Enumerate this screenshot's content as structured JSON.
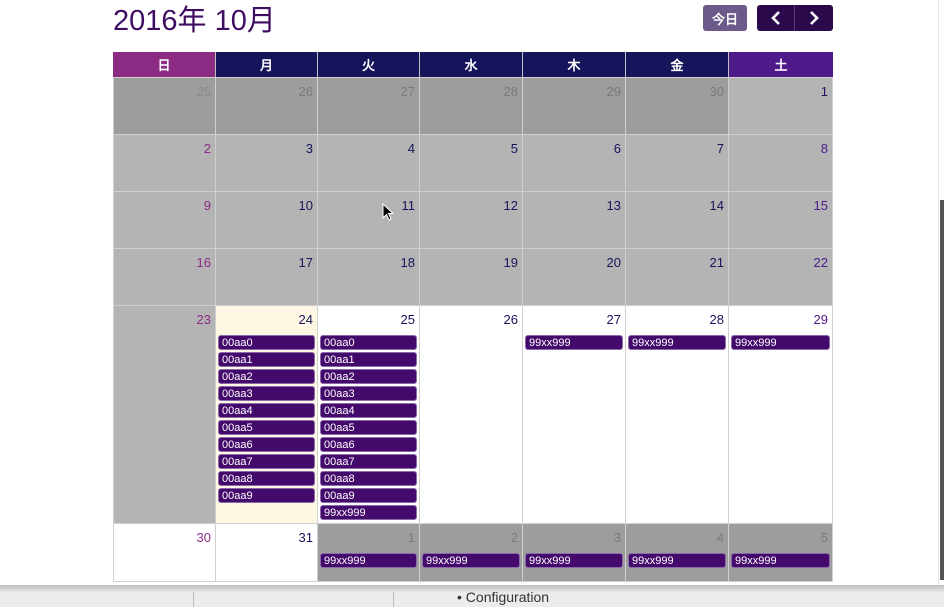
{
  "title": "2016年 10月",
  "buttons": {
    "today": "今日",
    "prev_icon": "chevron-left-icon",
    "next_icon": "chevron-right-icon"
  },
  "colors": {
    "accent": "#430a6b",
    "sunday_header": "#8b2b83",
    "weekday_header": "#16145a",
    "saturday_header": "#4e1a8a",
    "today_bg": "#fdf7e3"
  },
  "weekdays": [
    "日",
    "月",
    "火",
    "水",
    "木",
    "金",
    "土"
  ],
  "weeks": [
    [
      "25",
      "26",
      "27",
      "28",
      "29",
      "30",
      "1"
    ],
    [
      "2",
      "3",
      "4",
      "5",
      "6",
      "7",
      "8"
    ],
    [
      "9",
      "10",
      "11",
      "12",
      "13",
      "14",
      "15"
    ],
    [
      "16",
      "17",
      "18",
      "19",
      "20",
      "21",
      "22"
    ],
    [
      "23",
      "24",
      "25",
      "26",
      "27",
      "28",
      "29"
    ],
    [
      "30",
      "31",
      "1",
      "2",
      "3",
      "4",
      "5"
    ]
  ],
  "events": {
    "d24": [
      "00aa0",
      "00aa1",
      "00aa2",
      "00aa3",
      "00aa4",
      "00aa5",
      "00aa6",
      "00aa7",
      "00aa8",
      "00aa9"
    ],
    "d25": [
      "00aa0",
      "00aa1",
      "00aa2",
      "00aa3",
      "00aa4",
      "00aa5",
      "00aa6",
      "00aa7",
      "00aa8",
      "00aa9",
      "99xx999"
    ],
    "d27": [
      "99xx999"
    ],
    "d28": [
      "99xx999"
    ],
    "d29": [
      "99xx999"
    ],
    "nov1": [
      "99xx999"
    ],
    "nov2": [
      "99xx999"
    ],
    "nov3": [
      "99xx999"
    ],
    "nov4": [
      "99xx999"
    ],
    "nov5": [
      "99xx999"
    ]
  },
  "footer": {
    "bullet_item": "Configuration"
  }
}
